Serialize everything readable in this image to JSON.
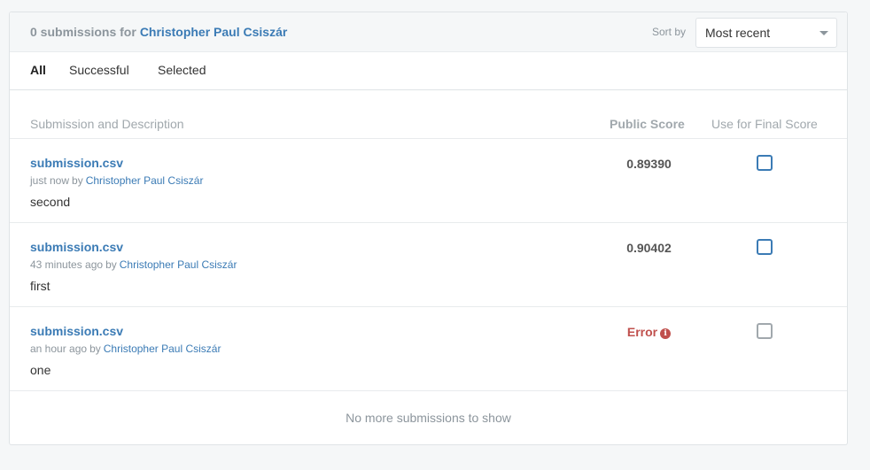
{
  "header": {
    "count_text": "0 submissions for",
    "user_name": "Christopher Paul Csiszár",
    "sort_label": "Sort by",
    "sort_value": "Most recent"
  },
  "tabs": [
    {
      "label": "All",
      "active": true
    },
    {
      "label": "Successful",
      "active": false
    },
    {
      "label": "Selected",
      "active": false
    }
  ],
  "columns": {
    "submission": "Submission and Description",
    "public_score": "Public Score",
    "final_score": "Use for Final Score"
  },
  "submissions": [
    {
      "file": "submission.csv",
      "time": "just now",
      "by": "by",
      "author": "Christopher Paul Csiszár",
      "description": "second",
      "score": "0.89390",
      "error": false
    },
    {
      "file": "submission.csv",
      "time": "43 minutes ago",
      "by": "by",
      "author": "Christopher Paul Csiszár",
      "description": "first",
      "score": "0.90402",
      "error": false
    },
    {
      "file": "submission.csv",
      "time": "an hour ago",
      "by": "by",
      "author": "Christopher Paul Csiszár",
      "description": "one",
      "score": "Error",
      "error": true
    }
  ],
  "footer": "No more submissions to show",
  "colors": {
    "link": "#3b7bb5",
    "error": "#c0504d",
    "muted": "#8c959c"
  },
  "icons": {
    "error_info": "info-circle-icon",
    "dropdown": "caret-down-icon"
  }
}
